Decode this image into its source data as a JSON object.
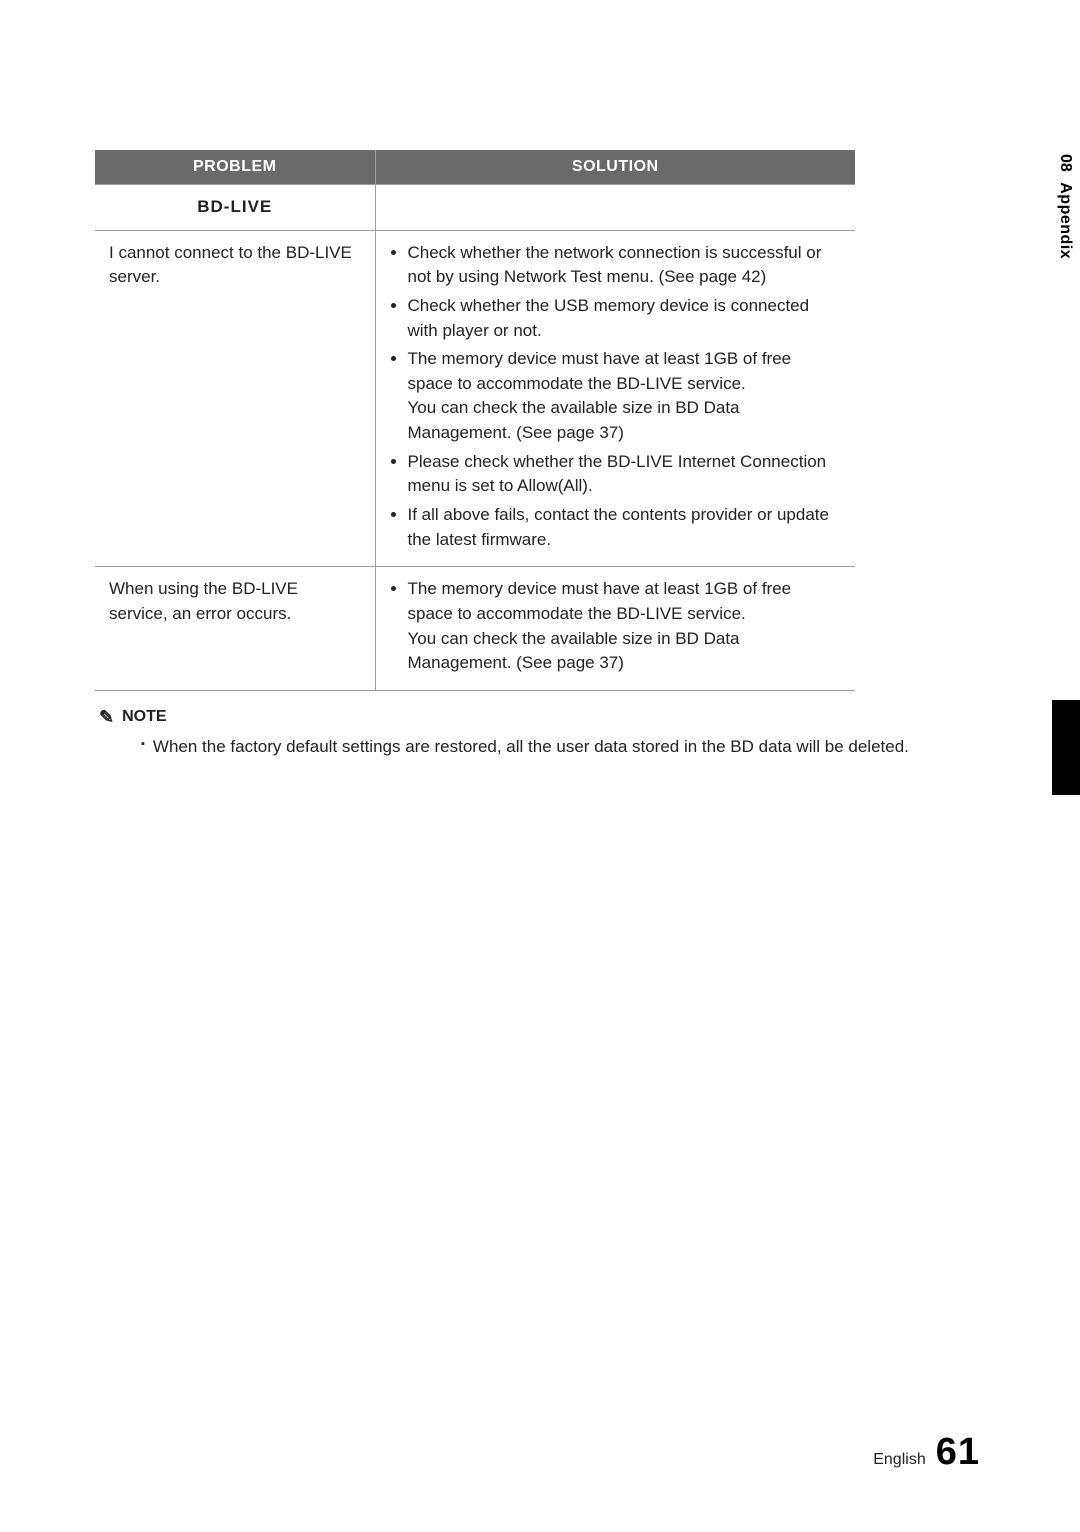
{
  "side": {
    "section_number": "08",
    "section_label": "Appendix"
  },
  "table": {
    "headers": {
      "problem": "PROBLEM",
      "solution": "SOLUTION"
    },
    "subhead": "BD-LIVE",
    "rows": [
      {
        "problem": "I cannot connect to the BD-LIVE server.",
        "solutions": [
          {
            "text": "Check whether the network connection is successful or not by using Network Test menu. (See page 42)"
          },
          {
            "text": "Check whether the USB memory device is connected with player or not."
          },
          {
            "text": "The memory device must have at least 1GB of free space to accommodate the BD-LIVE service.",
            "sub": "You can check the available size in BD Data Management. (See page 37)"
          },
          {
            "text": "Please check whether the BD-LIVE Internet Connection menu is set to Allow(All)."
          },
          {
            "text": "If all above fails, contact the contents provider or update the latest firmware."
          }
        ]
      },
      {
        "problem": "When using the BD-LIVE service, an error occurs.",
        "solutions": [
          {
            "text": "The memory device must have at least 1GB of free space to accommodate the BD-LIVE service.",
            "sub": "You can check the available size in BD Data Management. (See page 37)"
          }
        ]
      }
    ]
  },
  "note": {
    "label": "NOTE",
    "text": "When the factory default settings are restored, all the user data stored in the BD data will be deleted."
  },
  "footer": {
    "language": "English",
    "page": "61"
  }
}
